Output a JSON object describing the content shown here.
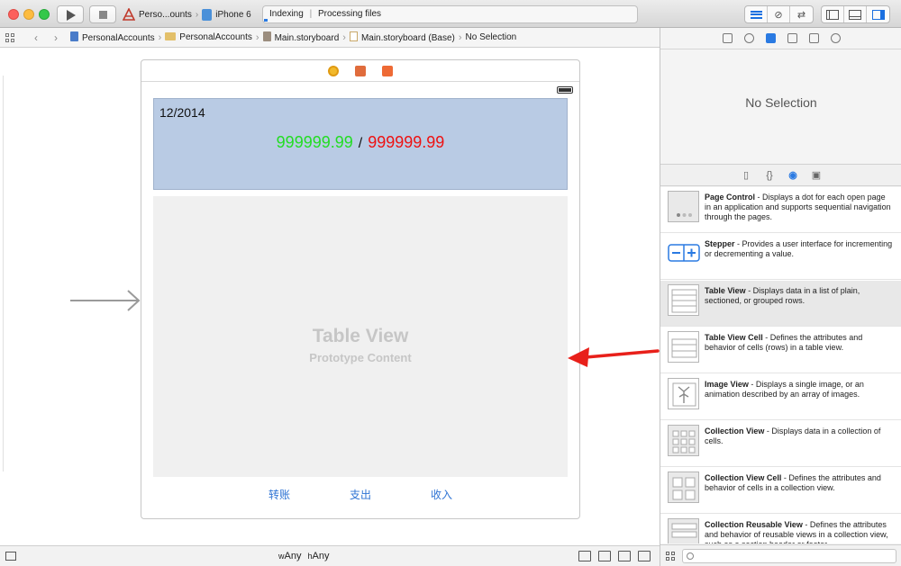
{
  "toolbar": {
    "scheme_app": "Perso...ounts",
    "scheme_device": "iPhone 6",
    "activity_status": "Indexing",
    "activity_detail": "Processing files"
  },
  "jumpbar": {
    "crumbs": [
      "PersonalAccounts",
      "PersonalAccounts",
      "Main.storyboard",
      "Main.storyboard (Base)",
      "No Selection"
    ]
  },
  "scene": {
    "date": "12/2014",
    "income": "999999.99",
    "separator": "/",
    "expense": "999999.99",
    "income_color": "#22dd22",
    "expense_color": "#ee1111",
    "table_title": "Table View",
    "table_subtitle": "Prototype Content",
    "buttons": [
      "转账",
      "支出",
      "收入"
    ]
  },
  "bottom_bar": {
    "width_label": "w",
    "width_value": "Any",
    "height_label": "h",
    "height_value": "Any"
  },
  "inspector": {
    "empty_label": "No Selection"
  },
  "library": {
    "items": [
      {
        "name": "Page Control",
        "desc": " - Displays a dot for each open page in an application and supports sequential navigation through the pages."
      },
      {
        "name": "Stepper",
        "desc": " - Provides a user interface for incrementing or decrementing a value."
      },
      {
        "name": "Table View",
        "desc": " - Displays data in a list of plain, sectioned, or grouped rows."
      },
      {
        "name": "Table View Cell",
        "desc": " - Defines the attributes and behavior of cells (rows) in a table view."
      },
      {
        "name": "Image View",
        "desc": " - Displays a single image, or an animation described by an array of images."
      },
      {
        "name": "Collection View",
        "desc": " - Displays data in a collection of cells."
      },
      {
        "name": "Collection View Cell",
        "desc": " - Defines the attributes and behavior of cells in a collection view."
      },
      {
        "name": "Collection Reusable View",
        "desc": " - Defines the attributes and behavior of reusable views in a collection view, such as a section header or footer."
      }
    ],
    "selected_item": "Table View"
  },
  "colors": {
    "accent": "#2a7ae2",
    "header_view_bg": "#b9cbe4",
    "annotation_arrow": "#e8201a"
  }
}
